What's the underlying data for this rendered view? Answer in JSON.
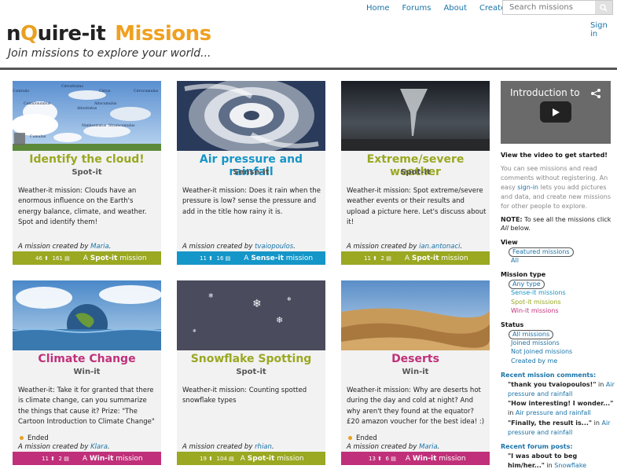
{
  "nav": {
    "home": "Home",
    "forums": "Forums",
    "about": "About",
    "create": "Create",
    "search_placeholder": "Search missions",
    "signin": "Sign in"
  },
  "brand": {
    "site": "nQuire-it",
    "section": "Missions",
    "tagline": "Join missions to explore your world..."
  },
  "missions": [
    {
      "title": "Identify the cloud!",
      "type": "Spot-it",
      "description": "Weather-it mission: Clouds have an enormous influence on the Earth's energy balance, climate, and weather. Spot and identify them!",
      "ended": "",
      "creator_prefix": "A mission created by",
      "creator": "Maria",
      "likes": "46",
      "comments": "161",
      "bar_prefix": "A",
      "bar_kind": "Spot-it",
      "bar_suffix": "mission",
      "image_labels": [
        "Cirrostratus",
        "Cirrus",
        "Cirrocumulus",
        "Contrails",
        "Cumulonimbus",
        "Altostratus",
        "Altocumulus",
        "Nimbostratus",
        "Stratocumulus",
        "Cumulus"
      ]
    },
    {
      "title": "Air pressure and rainfall",
      "type": "Sense-it",
      "description": "Weather-it mission: Does it rain when the pressure is low? sense the pressure and add in the title how rainy it is.",
      "ended": "",
      "creator_prefix": "A mission created by",
      "creator": "tvaiopoulos",
      "likes": "11",
      "comments": "16",
      "bar_prefix": "A",
      "bar_kind": "Sense-it",
      "bar_suffix": "mission"
    },
    {
      "title": "Extreme/severe weather",
      "type": "Spot-it",
      "description": "Weather-it mission: Spot extreme/severe weather events or their results and upload a picture here. Let's discuss about it!",
      "ended": "",
      "creator_prefix": "A mission created by",
      "creator": "ian.antonaci",
      "likes": "11",
      "comments": "2",
      "bar_prefix": "A",
      "bar_kind": "Spot-it",
      "bar_suffix": "mission"
    },
    {
      "title": "Climate Change",
      "type": "Win-it",
      "description": "Weather-it: Take it for granted that there is climate change, can you summarize the things that cause it? Prize: \"The Cartoon Introduction to Climate Change\"",
      "ended": "Ended",
      "creator_prefix": "A mission created by",
      "creator": "Klara",
      "likes": "11",
      "comments": "2",
      "bar_prefix": "A",
      "bar_kind": "Win-it",
      "bar_suffix": "mission"
    },
    {
      "title": "Snowflake Spotting",
      "type": "Spot-it",
      "description": "Weather-it mission: Counting spotted snowflake types",
      "ended": "",
      "creator_prefix": "A mission created by",
      "creator": "rhian",
      "likes": "19",
      "comments": "104",
      "bar_prefix": "A",
      "bar_kind": "Spot-it",
      "bar_suffix": "mission"
    },
    {
      "title": "Deserts",
      "type": "Win-it",
      "description": "Weather-it mission: Why are deserts hot during the day and cold at night? And why aren't they found at the equator? £20 amazon voucher for the best idea! :)",
      "ended": "Ended",
      "creator_prefix": "A mission created by",
      "creator": "Maria",
      "likes": "13",
      "comments": "6",
      "bar_prefix": "A",
      "bar_kind": "Win-it",
      "bar_suffix": "mission"
    }
  ],
  "sidebar": {
    "video_title": "Introduction to",
    "video_cta": "View the video to get started!",
    "intro_1": "You can see missions and read comments without registering. An easy",
    "intro_link": "sign-in",
    "intro_2": "lets you add pictures and data, and create new missions for other people to explore.",
    "note_label": "NOTE:",
    "note_1": "To see all the missions click",
    "note_all": "All",
    "note_2": "below.",
    "view_heading": "View",
    "view_options": [
      "Featured missions",
      "All"
    ],
    "type_heading": "Mission type",
    "type_options": [
      "Any type",
      "Sense-it missions",
      "Spot-it missions",
      "Win-it missions"
    ],
    "status_heading": "Status",
    "status_options": [
      "All missions",
      "Joined missions",
      "Not joined missions",
      "Created by me"
    ],
    "recent_comments_heading": "Recent mission comments:",
    "comments": [
      {
        "quote": "\"thank you tvaiopoulos!\"",
        "in": "in",
        "mission": "Air pressure and rainfall"
      },
      {
        "quote": "\"How interesting! I wonder...\"",
        "in": "in",
        "mission": "Air pressure and rainfall"
      },
      {
        "quote": "\"Finally, the result is...\"",
        "in": "in",
        "mission": "Air pressure and rainfall"
      }
    ],
    "recent_forum_heading": "Recent forum posts:",
    "forum_posts": [
      {
        "quote": "\"I was about to beg him/her...\"",
        "in": "in",
        "topic": "Snowflake Spotting!"
      }
    ]
  },
  "colors": {
    "spot": "#9aa822",
    "sense": "#1596c8",
    "win": "#c0307a",
    "link": "#1a73a8",
    "brand_orange": "#f0a020"
  }
}
